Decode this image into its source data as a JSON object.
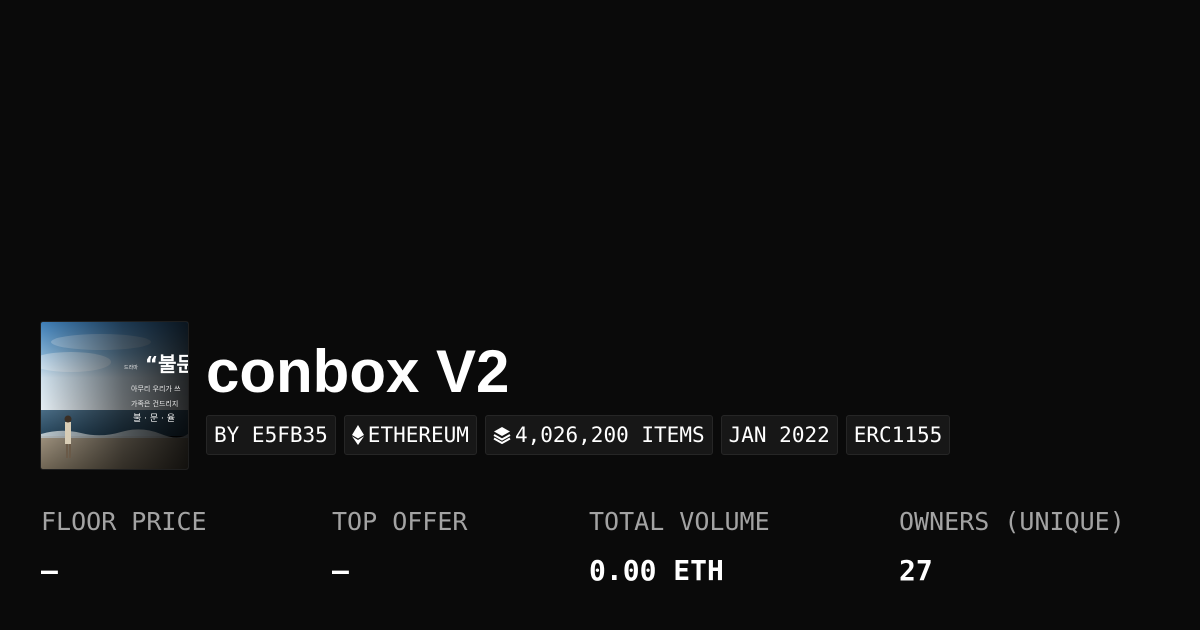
{
  "collection": {
    "name": "conbox V2",
    "thumbnail": {
      "quote": "“불문",
      "small": "드라마",
      "line1": "아무리 우리가 쓰",
      "line2": "가족은 건드리지",
      "line3": "불 · 문 · 율"
    },
    "tags": {
      "creator": "BY E5FB35",
      "chain": "ETHEREUM",
      "chain_icon": "ethereum-icon",
      "items": "4,026,200 ITEMS",
      "items_icon": "layers-icon",
      "date": "JAN 2022",
      "standard": "ERC1155"
    }
  },
  "stats": {
    "floor_price": {
      "label": "FLOOR PRICE",
      "value": "–"
    },
    "top_offer": {
      "label": "TOP OFFER",
      "value": "–"
    },
    "total_volume": {
      "label": "TOTAL VOLUME",
      "value": "0.00 ETH"
    },
    "owners": {
      "label": "OWNERS (UNIQUE)",
      "value": "27"
    }
  },
  "colors": {
    "background": "#0a0a0a",
    "tag_background": "#171717",
    "label": "#a3a3a3",
    "text": "#ffffff"
  }
}
